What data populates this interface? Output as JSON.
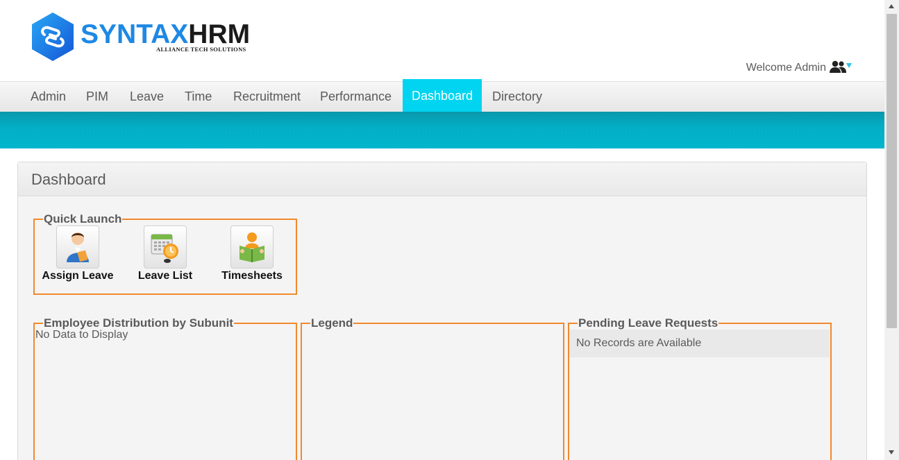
{
  "app": {
    "logo_name": "SYNTAX",
    "logo_suffix": "HRM",
    "logo_tagline": "ALLIANCE TECH SOLUTIONS",
    "brand_color": "#1e88e5"
  },
  "header": {
    "welcome_text": "Welcome Admin",
    "user_icon": "users-icon"
  },
  "nav": {
    "items": [
      {
        "label": "Admin"
      },
      {
        "label": "PIM"
      },
      {
        "label": "Leave"
      },
      {
        "label": "Time"
      },
      {
        "label": "Recruitment"
      },
      {
        "label": "Performance"
      },
      {
        "label": "Dashboard"
      },
      {
        "label": "Directory"
      }
    ],
    "active": "Dashboard",
    "active_color": "#00d4f0"
  },
  "dashboard": {
    "title": "Dashboard",
    "quick_launch": {
      "legend": "Quick Launch",
      "items": [
        {
          "label": "Assign Leave",
          "icon": "assign-leave-icon"
        },
        {
          "label": "Leave List",
          "icon": "leave-list-icon"
        },
        {
          "label": "Timesheets",
          "icon": "timesheets-icon"
        }
      ]
    },
    "distribution": {
      "legend": "Employee Distribution by Subunit",
      "empty_text": "No Data to Display"
    },
    "legend_panel": {
      "legend": "Legend"
    },
    "pending_leave": {
      "legend": "Pending Leave Requests",
      "empty_text": "No Records are Available"
    },
    "accent_color": "#f0892d"
  }
}
